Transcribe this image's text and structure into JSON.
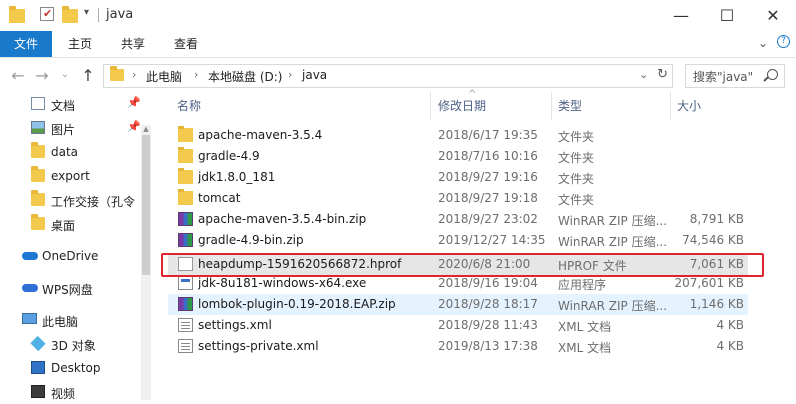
{
  "window": {
    "title": "java"
  },
  "ribbon": {
    "tabs": [
      "文件",
      "主页",
      "共享",
      "查看"
    ]
  },
  "nav": {
    "path": [
      "此电脑",
      "本地磁盘 (D:)",
      "java"
    ],
    "search_placeholder": "搜索\"java\""
  },
  "sidebar": {
    "items": [
      {
        "label": "文档",
        "icon": "document-icon",
        "pinned": true
      },
      {
        "label": "图片",
        "icon": "picture-icon",
        "pinned": true
      },
      {
        "label": "data",
        "icon": "folder-icon"
      },
      {
        "label": "export",
        "icon": "folder-icon"
      },
      {
        "label": "工作交接（孔令",
        "icon": "folder-icon"
      },
      {
        "label": "桌面",
        "icon": "folder-icon"
      },
      {
        "label": "OneDrive",
        "icon": "cloud-icon"
      },
      {
        "label": "WPS网盘",
        "icon": "cloud-icon"
      },
      {
        "label": "此电脑",
        "icon": "computer-icon"
      },
      {
        "label": "3D 对象",
        "icon": "cube-icon"
      },
      {
        "label": "Desktop",
        "icon": "desktop-icon"
      },
      {
        "label": "视频",
        "icon": "video-icon"
      }
    ]
  },
  "columns": {
    "name": "名称",
    "modified": "修改日期",
    "type": "类型",
    "size": "大小"
  },
  "files": [
    {
      "name": "apache-maven-3.5.4",
      "modified": "2018/6/17 19:35",
      "type": "文件夹",
      "size": "",
      "icon": "folder"
    },
    {
      "name": "gradle-4.9",
      "modified": "2018/7/16 10:16",
      "type": "文件夹",
      "size": "",
      "icon": "folder"
    },
    {
      "name": "jdk1.8.0_181",
      "modified": "2018/9/27 19:16",
      "type": "文件夹",
      "size": "",
      "icon": "folder"
    },
    {
      "name": "tomcat",
      "modified": "2018/9/27 19:18",
      "type": "文件夹",
      "size": "",
      "icon": "folder"
    },
    {
      "name": "apache-maven-3.5.4-bin.zip",
      "modified": "2018/9/27 23:02",
      "type": "WinRAR ZIP 压缩...",
      "size": "8,791 KB",
      "icon": "zip"
    },
    {
      "name": "gradle-4.9-bin.zip",
      "modified": "2019/12/27 14:35",
      "type": "WinRAR ZIP 压缩...",
      "size": "74,546 KB",
      "icon": "zip"
    },
    {
      "name": "heapdump-1591620566872.hprof",
      "modified": "2020/6/8 21:00",
      "type": "HPROF 文件",
      "size": "7,061 KB",
      "icon": "file"
    },
    {
      "name": "jdk-8u181-windows-x64.exe",
      "modified": "2018/9/16 19:04",
      "type": "应用程序",
      "size": "207,601 KB",
      "icon": "exe"
    },
    {
      "name": "lombok-plugin-0.19-2018.EAP.zip",
      "modified": "2018/9/28 18:17",
      "type": "WinRAR ZIP 压缩...",
      "size": "1,146 KB",
      "icon": "zip"
    },
    {
      "name": "settings.xml",
      "modified": "2018/9/28 11:43",
      "type": "XML 文档",
      "size": "4 KB",
      "icon": "xml"
    },
    {
      "name": "settings-private.xml",
      "modified": "2019/8/13 17:38",
      "type": "XML 文档",
      "size": "4 KB",
      "icon": "xml"
    }
  ]
}
